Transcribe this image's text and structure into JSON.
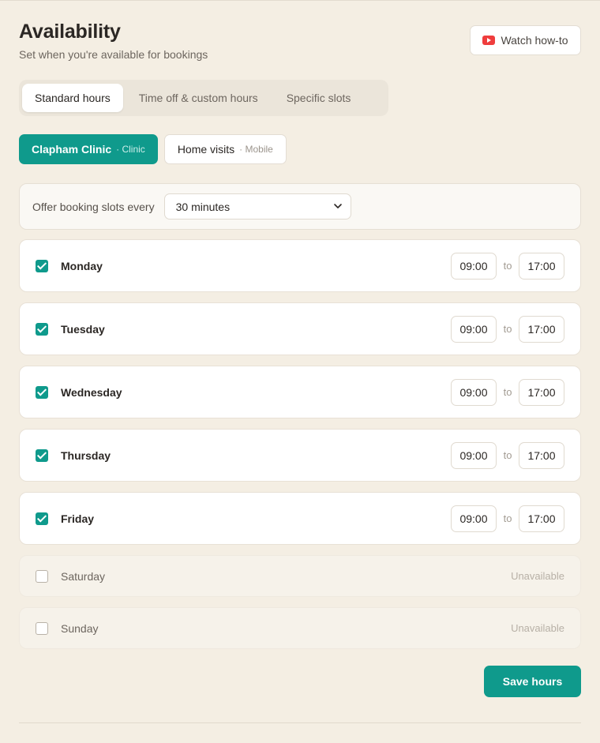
{
  "header": {
    "title": "Availability",
    "subtitle": "Set when you're available for bookings",
    "watch_label": "Watch how-to",
    "watch_icon": "youtube-icon"
  },
  "tabs": [
    {
      "label": "Standard hours",
      "active": true
    },
    {
      "label": "Time off & custom hours",
      "active": false
    },
    {
      "label": "Specific slots",
      "active": false
    }
  ],
  "locations": [
    {
      "name": "Clapham Clinic",
      "type": "· Clinic",
      "active": true
    },
    {
      "name": "Home visits",
      "type": "· Mobile",
      "active": false
    }
  ],
  "slots": {
    "label": "Offer booking slots every",
    "selected": "30 minutes"
  },
  "connector": "to",
  "days": [
    {
      "name": "Monday",
      "enabled": true,
      "start": "09:00",
      "end": "17:00"
    },
    {
      "name": "Tuesday",
      "enabled": true,
      "start": "09:00",
      "end": "17:00"
    },
    {
      "name": "Wednesday",
      "enabled": true,
      "start": "09:00",
      "end": "17:00"
    },
    {
      "name": "Thursday",
      "enabled": true,
      "start": "09:00",
      "end": "17:00"
    },
    {
      "name": "Friday",
      "enabled": true,
      "start": "09:00",
      "end": "17:00"
    },
    {
      "name": "Saturday",
      "enabled": false,
      "status": "Unavailable"
    },
    {
      "name": "Sunday",
      "enabled": false,
      "status": "Unavailable"
    }
  ],
  "save_label": "Save hours",
  "colors": {
    "accent": "#0f9a8c",
    "background": "#f4eee3",
    "youtube": "#ef3d3d"
  }
}
